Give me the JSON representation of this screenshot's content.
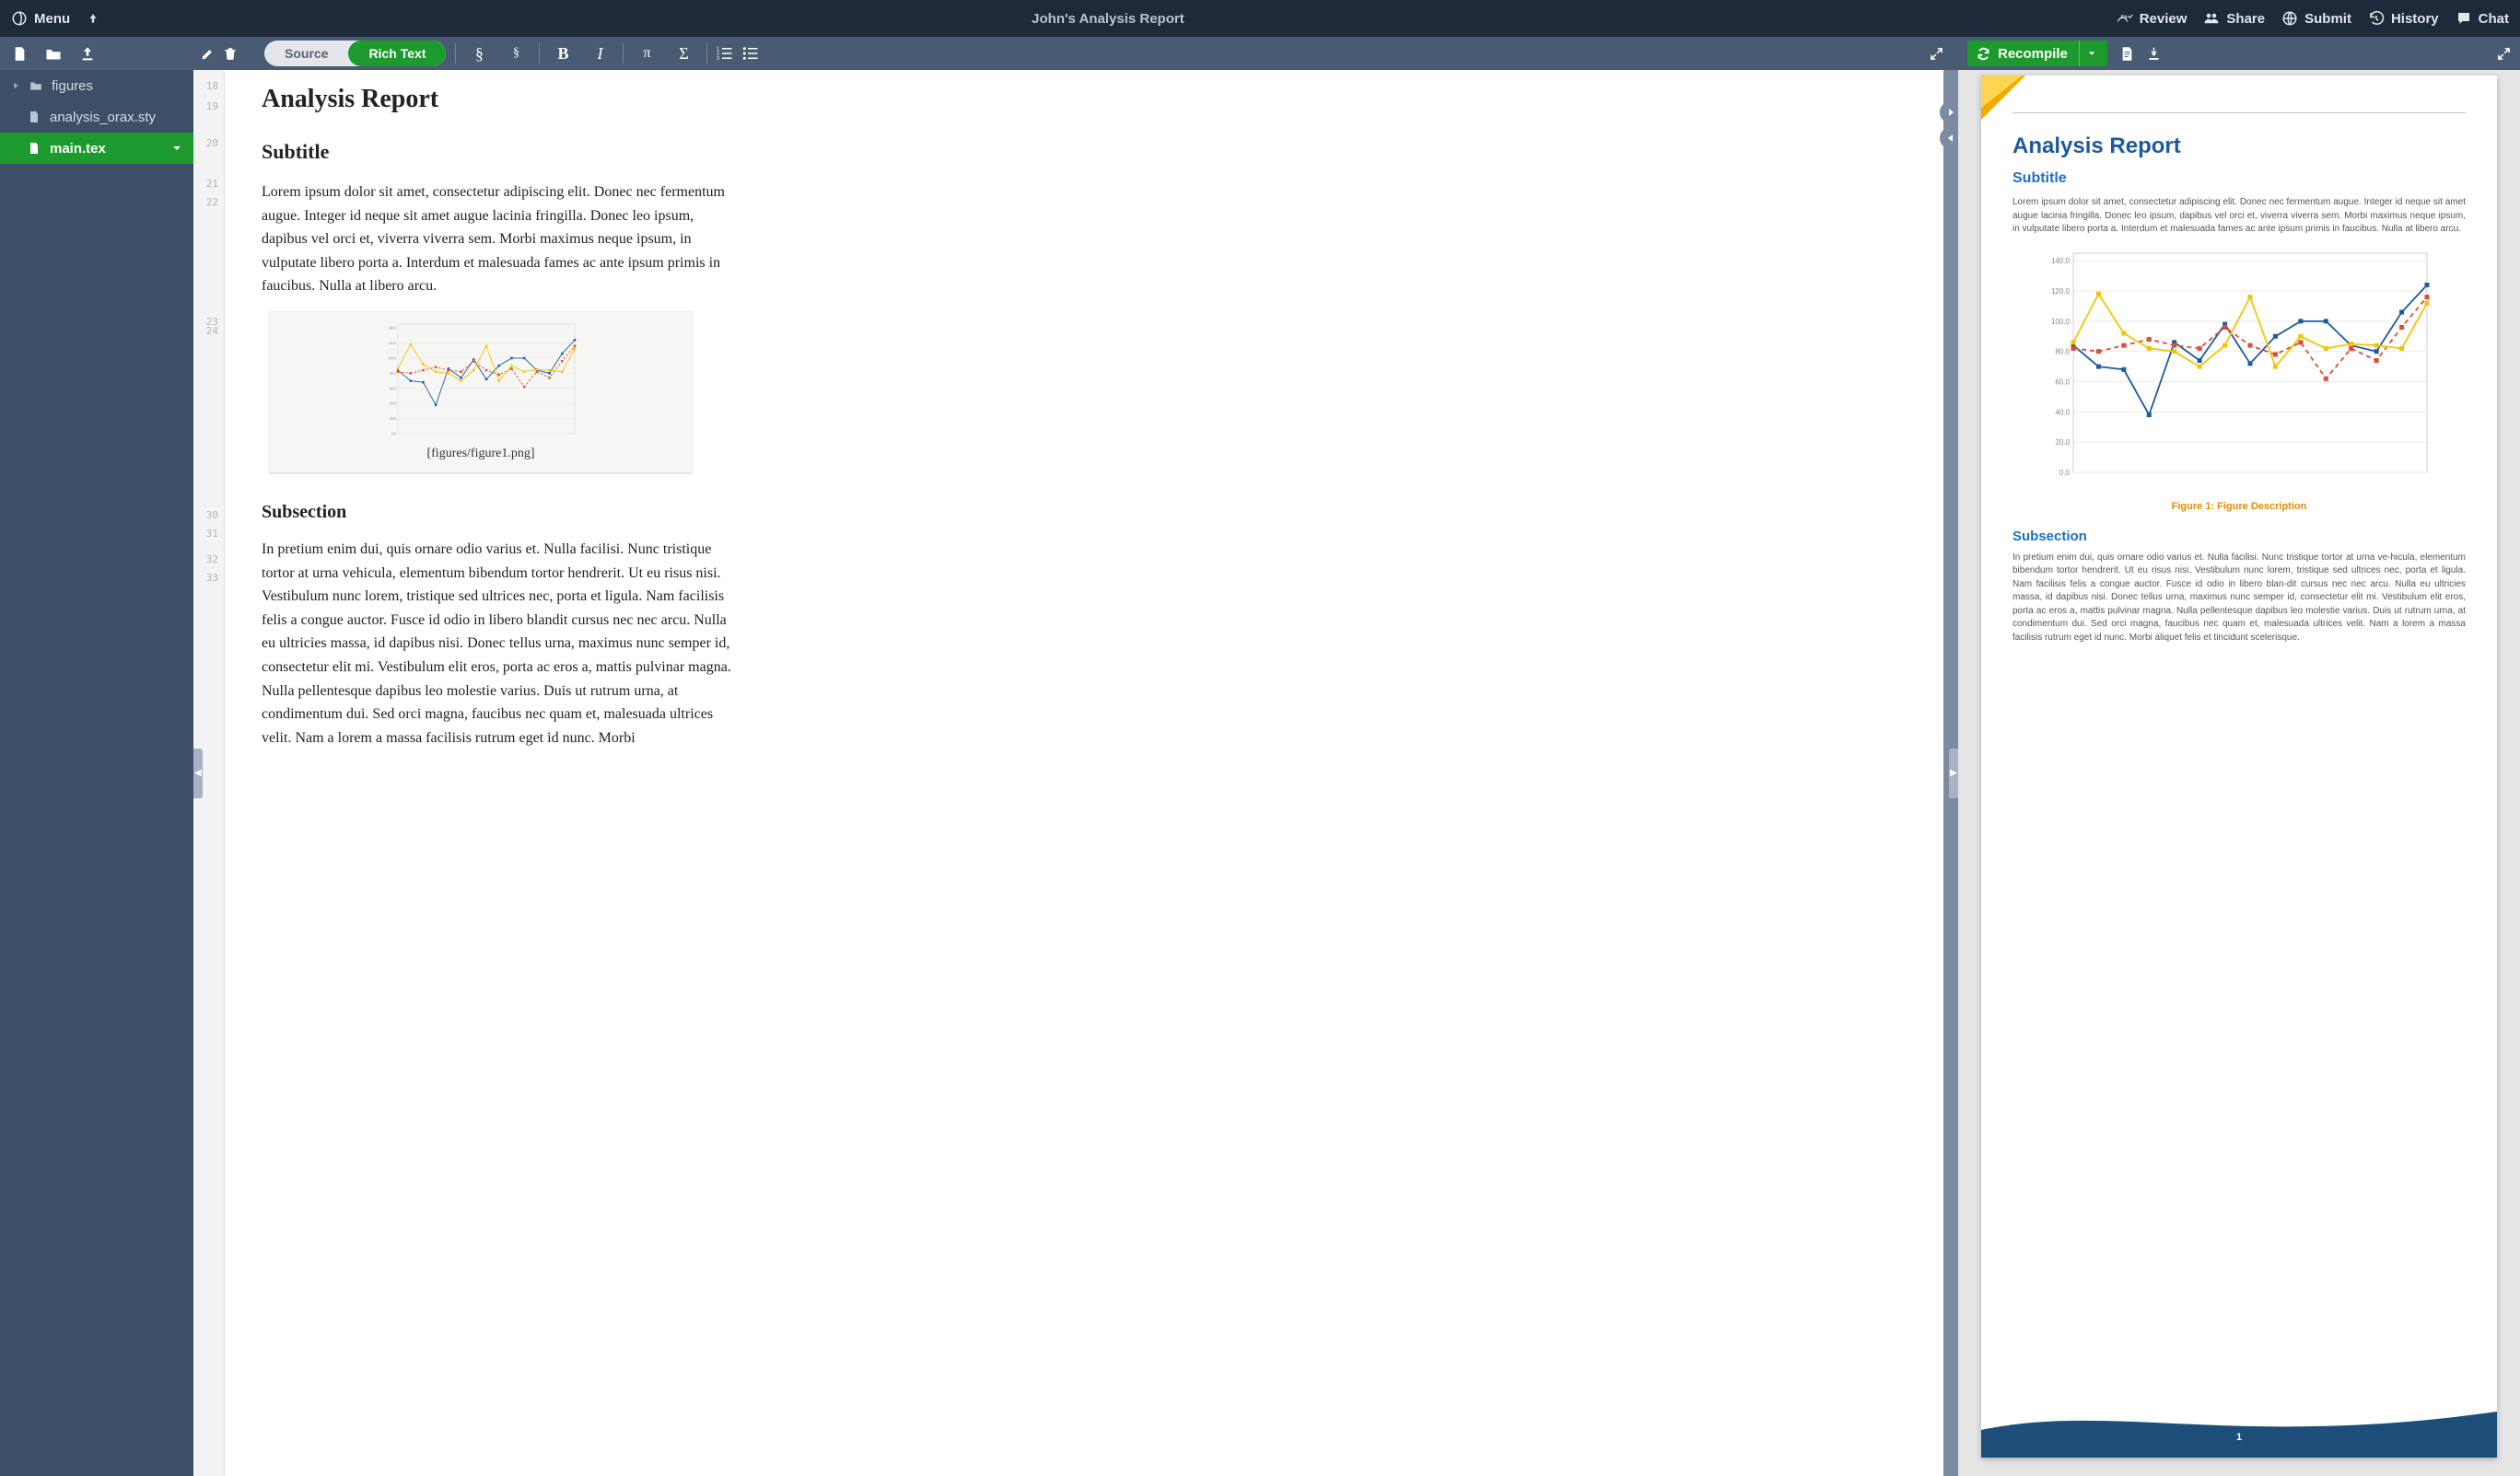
{
  "header": {
    "menu": "Menu",
    "title": "John's Analysis Report",
    "review": "Review",
    "share": "Share",
    "submit": "Submit",
    "history": "History",
    "chat": "Chat"
  },
  "toolbar": {
    "source": "Source",
    "richtext": "Rich Text",
    "recompile": "Recompile"
  },
  "files": {
    "folder": "figures",
    "sty": "analysis_orax.sty",
    "main": "main.tex"
  },
  "gutter": [
    "18",
    "19",
    "20",
    "21",
    "22",
    "23",
    "24",
    "30",
    "31",
    "32",
    "33"
  ],
  "editor": {
    "h1": "Analysis Report",
    "h2": "Subtitle",
    "p1": "Lorem ipsum dolor sit amet, consectetur adipiscing elit. Donec nec fermentum augue. Integer id neque sit amet augue lacinia fringilla. Donec leo ipsum, dapibus vel orci et, viverra viverra sem. Morbi maximus neque ipsum, in vulputate libero porta a. Interdum et malesuada fames ac ante ipsum primis in faucibus. Nulla at libero arcu.",
    "figcap": "[figures/figure1.png]",
    "h3": "Subsection",
    "p2": "In pretium enim dui, quis ornare odio varius et. Nulla facilisi. Nunc tristique tortor at urna vehicula, elementum bibendum tortor hendrerit. Ut eu risus nisi. Vestibulum nunc lorem, tristique sed ultrices nec, porta et ligula. Nam facilisis felis a congue auctor. Fusce id odio in libero blandit cursus nec nec arcu. Nulla eu ultricies massa, id dapibus nisi. Donec tellus urna, maximus nunc semper id, consectetur elit mi. Vestibulum elit eros, porta ac eros a, mattis pulvinar magna. Nulla pellentesque dapibus leo molestie varius. Duis ut rutrum urna, at condimentum dui. Sed orci magna, faucibus nec quam et, malesuada ultrices velit. Nam a lorem a massa facilisis rutrum eget id nunc. Morbi"
  },
  "preview": {
    "h1": "Analysis Report",
    "h2": "Subtitle",
    "p1": "Lorem ipsum dolor sit amet, consectetur adipiscing elit. Donec nec fermentum augue. Integer id neque sit amet augue lacinia fringilla. Donec leo ipsum, dapibus vel orci et, viverra viverra sem. Morbi maximus neque ipsum, in vulputate libero porta a. Interdum et malesuada fames ac ante ipsum primis in faucibus. Nulla at libero arcu.",
    "figcap": "Figure 1: Figure Description",
    "h3": "Subsection",
    "p2": "In pretium enim dui, quis ornare odio varius et. Nulla facilisi. Nunc tristique tortor at urna ve-hicula, elementum bibendum tortor hendrerit. Ut eu risus nisi. Vestibulum nunc lorem, tristique sed ultrices nec, porta et ligula. Nam facilisis felis a congue auctor. Fusce id odio in libero blan-dit cursus nec nec arcu. Nulla eu ultricies massa, id dapibus nisi. Donec tellus urna, maximus nunc semper id, consectetur elit mi. Vestibulum elit eros, porta ac eros a, mattis pulvinar magna. Nulla pellentesque dapibus leo molestie varius. Duis ut rutrum urna, at condimentum dui. Sed orci magna, faucibus nec quam et, malesuada ultrices velit. Nam a lorem a massa facilisis rutrum eget id nunc. Morbi aliquet felis et tincidunt scelerisque.",
    "pagenum": "1"
  },
  "chart_data": {
    "type": "line",
    "yticks": [
      0,
      20,
      40,
      60,
      80,
      100,
      120,
      140
    ],
    "ylim": [
      0,
      145
    ],
    "x_count": 15,
    "series": [
      {
        "name": "blue",
        "color": "#1d5a9d",
        "style": "solid",
        "values": [
          84,
          70,
          68,
          38,
          86,
          74,
          98,
          72,
          90,
          100,
          100,
          84,
          80,
          106,
          124
        ]
      },
      {
        "name": "red",
        "color": "#e24a33",
        "style": "dashed",
        "values": [
          82,
          80,
          84,
          88,
          84,
          82,
          96,
          84,
          78,
          86,
          62,
          82,
          74,
          96,
          116
        ]
      },
      {
        "name": "yellow",
        "color": "#f2c500",
        "style": "solid",
        "values": [
          86,
          118,
          92,
          82,
          80,
          70,
          84,
          116,
          70,
          90,
          82,
          85,
          84,
          82,
          112
        ]
      }
    ]
  }
}
